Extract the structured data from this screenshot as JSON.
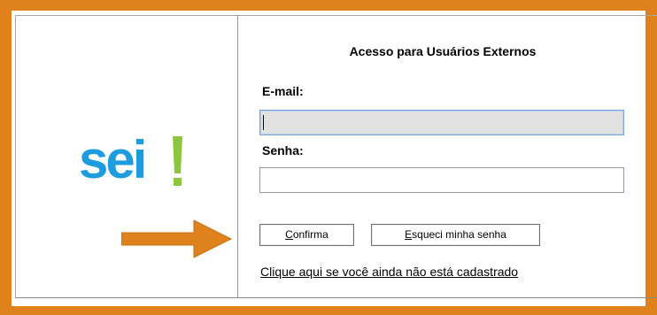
{
  "logo": {
    "word": "sei",
    "accent": "!",
    "brand_color": "#1d9de0",
    "accent_color": "#8cc63f"
  },
  "login": {
    "title": "Acesso para Usuários Externos",
    "email_label": "E-mail:",
    "email_value": "",
    "senha_label": "Senha:",
    "senha_value": ""
  },
  "buttons": {
    "confirma_first": "C",
    "confirma_rest": "onfirma",
    "esqueci_first": "E",
    "esqueci_rest": "squeci minha senha"
  },
  "links": {
    "cadastro": "Clique aqui se você ainda não está cadastrado"
  },
  "annotation": {
    "arrow_icon": "arrow-right-icon",
    "highlight_color": "#e0821c"
  }
}
